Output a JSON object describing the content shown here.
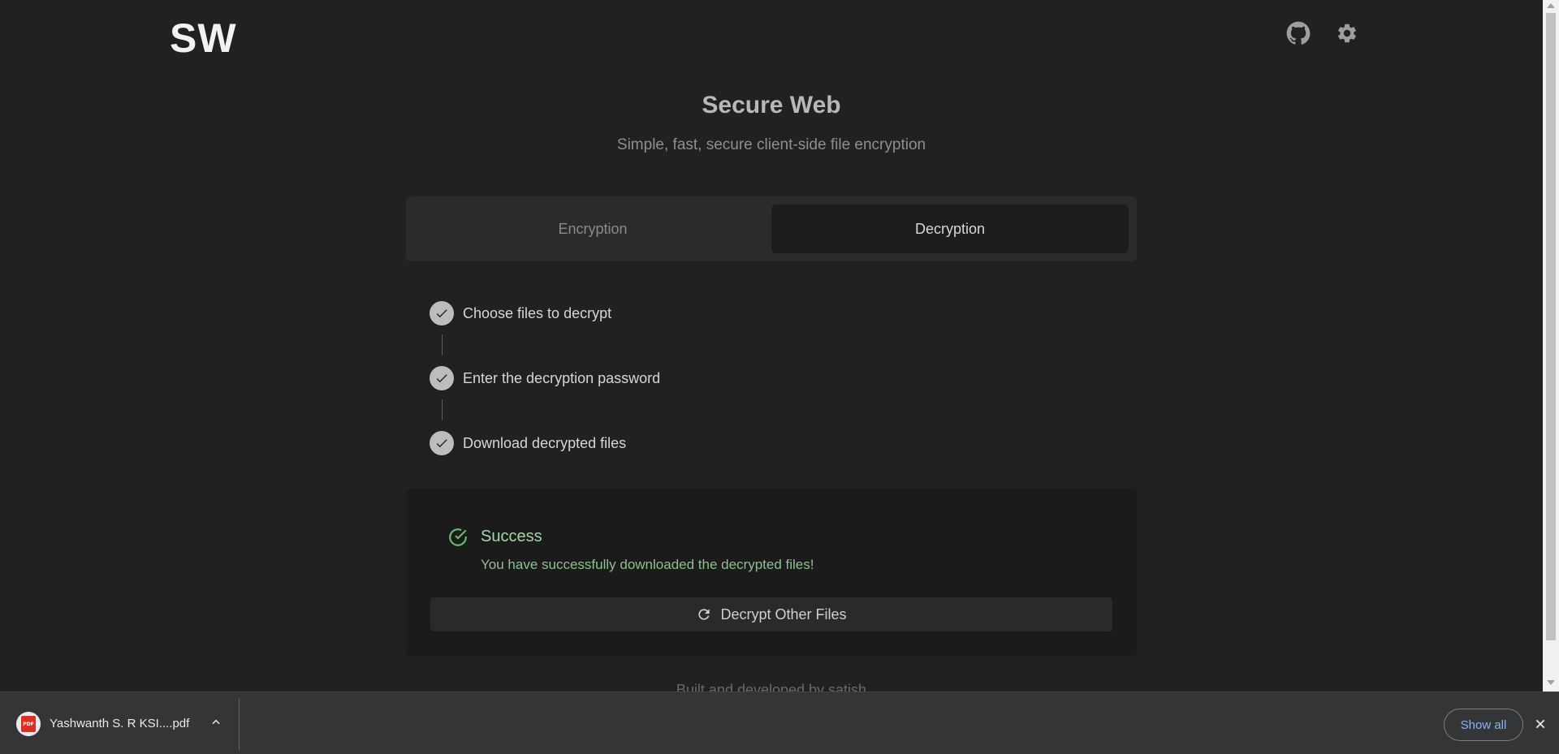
{
  "header": {
    "logo": "SW",
    "github_icon": "github-icon",
    "settings_icon": "gear-icon"
  },
  "hero": {
    "title": "Secure Web",
    "subtitle": "Simple, fast, secure client-side file encryption"
  },
  "tabs": [
    {
      "label": "Encryption",
      "active": false
    },
    {
      "label": "Decryption",
      "active": true
    }
  ],
  "steps": [
    {
      "label": "Choose files to decrypt",
      "done": true
    },
    {
      "label": "Enter the decryption password",
      "done": true
    },
    {
      "label": "Download decrypted files",
      "done": true
    }
  ],
  "result": {
    "title": "Success",
    "message": "You have successfully downloaded the decrypted files!",
    "button_label": "Decrypt Other Files",
    "button_icon": "refresh-icon"
  },
  "footer": {
    "text": "Built and developed by satish"
  },
  "download_bar": {
    "file_name": "Yashwanth S. R KSI....pdf",
    "file_icon": "pdf-file-icon",
    "file_badge": "PDF",
    "show_all_label": "Show all"
  },
  "colors": {
    "background": "#212121",
    "success": "#a5d6a7",
    "link": "#8ab4f8"
  }
}
